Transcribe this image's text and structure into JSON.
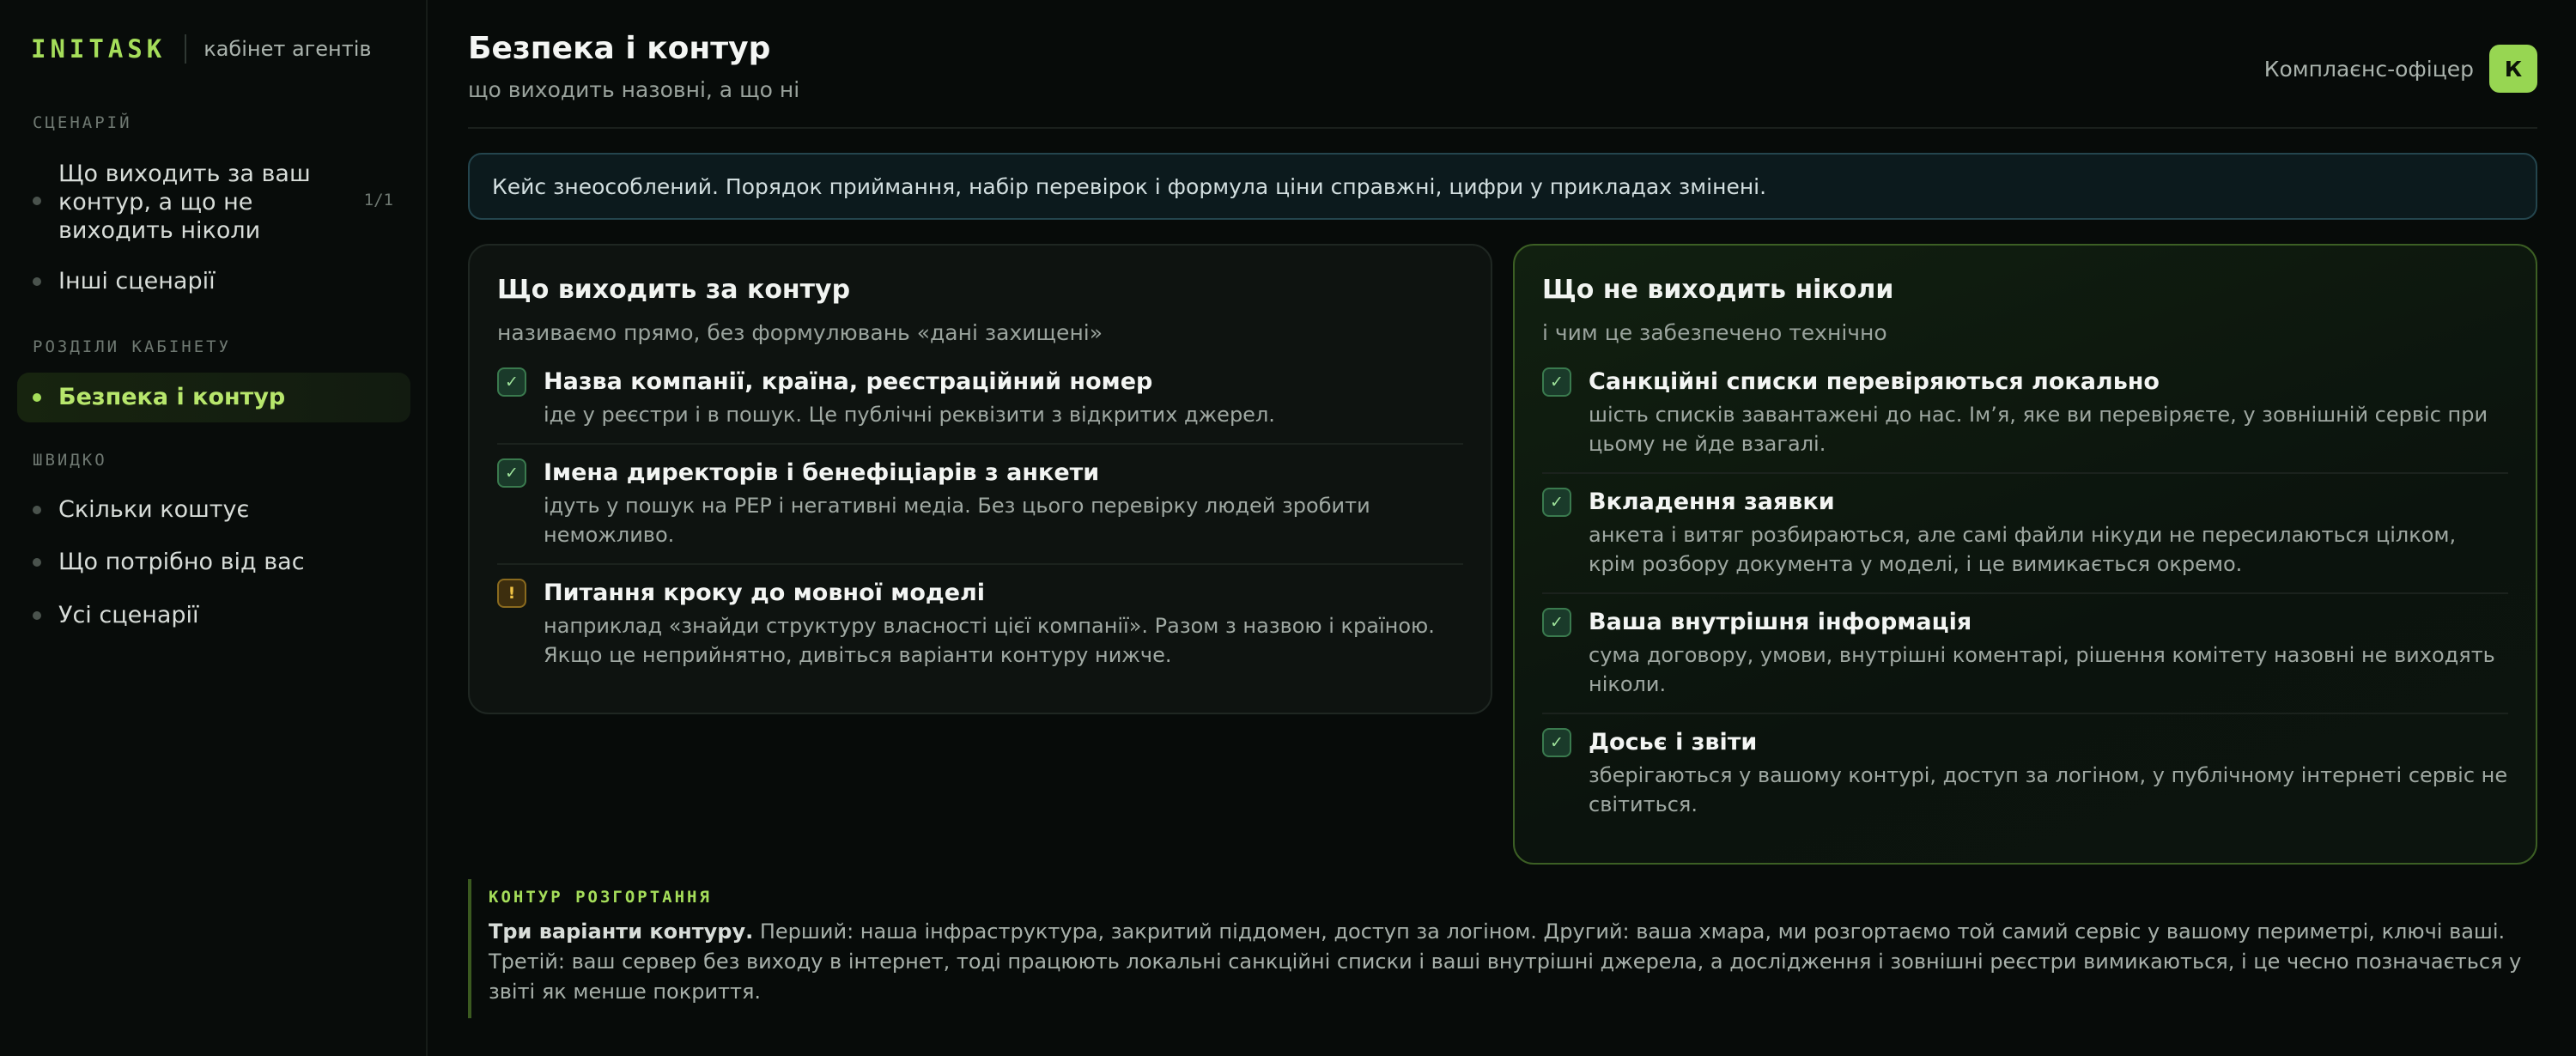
{
  "brand": {
    "name": "INITASK",
    "subtitle": "кабінет агентів"
  },
  "sidebar": {
    "sections": [
      {
        "label": "СЦЕНАРІЙ",
        "items": [
          {
            "label": "Що виходить за ваш контур, а що не виходить ніколи",
            "count": "1/1"
          },
          {
            "label": "Інші сценарії"
          }
        ]
      },
      {
        "label": "РОЗДІЛИ КАБІНЕТУ",
        "items": [
          {
            "label": "Безпека і контур",
            "active": true
          }
        ]
      },
      {
        "label": "ШВИДКО",
        "items": [
          {
            "label": "Скільки коштує"
          },
          {
            "label": "Що потрібно від вас"
          },
          {
            "label": "Усі сценарії"
          }
        ]
      }
    ]
  },
  "header": {
    "title": "Безпека і контур",
    "subtitle": "що виходить назовні, а що ні",
    "user_role": "Комплаєнс-офіцер",
    "avatar_letter": "К"
  },
  "notice": "Кейс знеособлений. Порядок приймання, набір перевірок і формула ціни справжні, цифри у прикладах змінені.",
  "cards": {
    "out": {
      "title": "Що виходить за контур",
      "subtitle": "називаємо прямо, без формулювань «дані захищені»",
      "items": [
        {
          "icon": "check-icon",
          "mark": "✓",
          "title": "Назва компанії, країна, реєстраційний номер",
          "desc": "іде у реєстри і в пошук. Це публічні реквізити з відкритих джерел."
        },
        {
          "icon": "check-icon",
          "mark": "✓",
          "title": "Імена директорів і бенефіціарів з анкети",
          "desc": "ідуть у пошук на PEP і негативні медіа. Без цього перевірку людей зробити неможливо."
        },
        {
          "icon": "warning-icon",
          "mark": "!",
          "title": "Питання кроку до мовної моделі",
          "desc": "наприклад «знайди структуру власності цієї компанії». Разом з назвою і країною. Якщо це неприйнятно, дивіться варіанти контуру нижче."
        }
      ]
    },
    "never": {
      "title": "Що не виходить ніколи",
      "subtitle": "і чим це забезпечено технічно",
      "items": [
        {
          "icon": "check-icon",
          "mark": "✓",
          "title": "Санкційні списки перевіряються локально",
          "desc": "шість списків завантажені до нас. Ім’я, яке ви перевіряєте, у зовнішній сервіс при цьому не йде взагалі."
        },
        {
          "icon": "check-icon",
          "mark": "✓",
          "title": "Вкладення заявки",
          "desc": "анкета і витяг розбираються, але самі файли нікуди не пересилаються цілком, крім розбору документа у моделі, і це вимикається окремо."
        },
        {
          "icon": "check-icon",
          "mark": "✓",
          "title": "Ваша внутрішня інформація",
          "desc": "сума договору, умови, внутрішні коментарі, рішення комітету назовні не виходять ніколи."
        },
        {
          "icon": "check-icon",
          "mark": "✓",
          "title": "Досьє і звіти",
          "desc": "зберігаються у вашому контурі, доступ за логіном, у публічному інтернеті сервіс не світиться."
        }
      ]
    }
  },
  "deployment": {
    "label": "КОНТУР РОЗГОРТАННЯ",
    "lead": "Три варіанти контуру.",
    "text": " Перший: наша інфраструктура, закритий піддомен, доступ за логіном. Другий: ваша хмара, ми розгортаємо той самий сервіс у вашому периметрі, ключі ваші. Третій: ваш сервер без виходу в інтернет, тоді працюють локальні санкційні списки і ваші внутрішні джерела, а дослідження і зовнішні реєстри вимикаються, і це чесно позначається у звіті як менше покриття."
  }
}
